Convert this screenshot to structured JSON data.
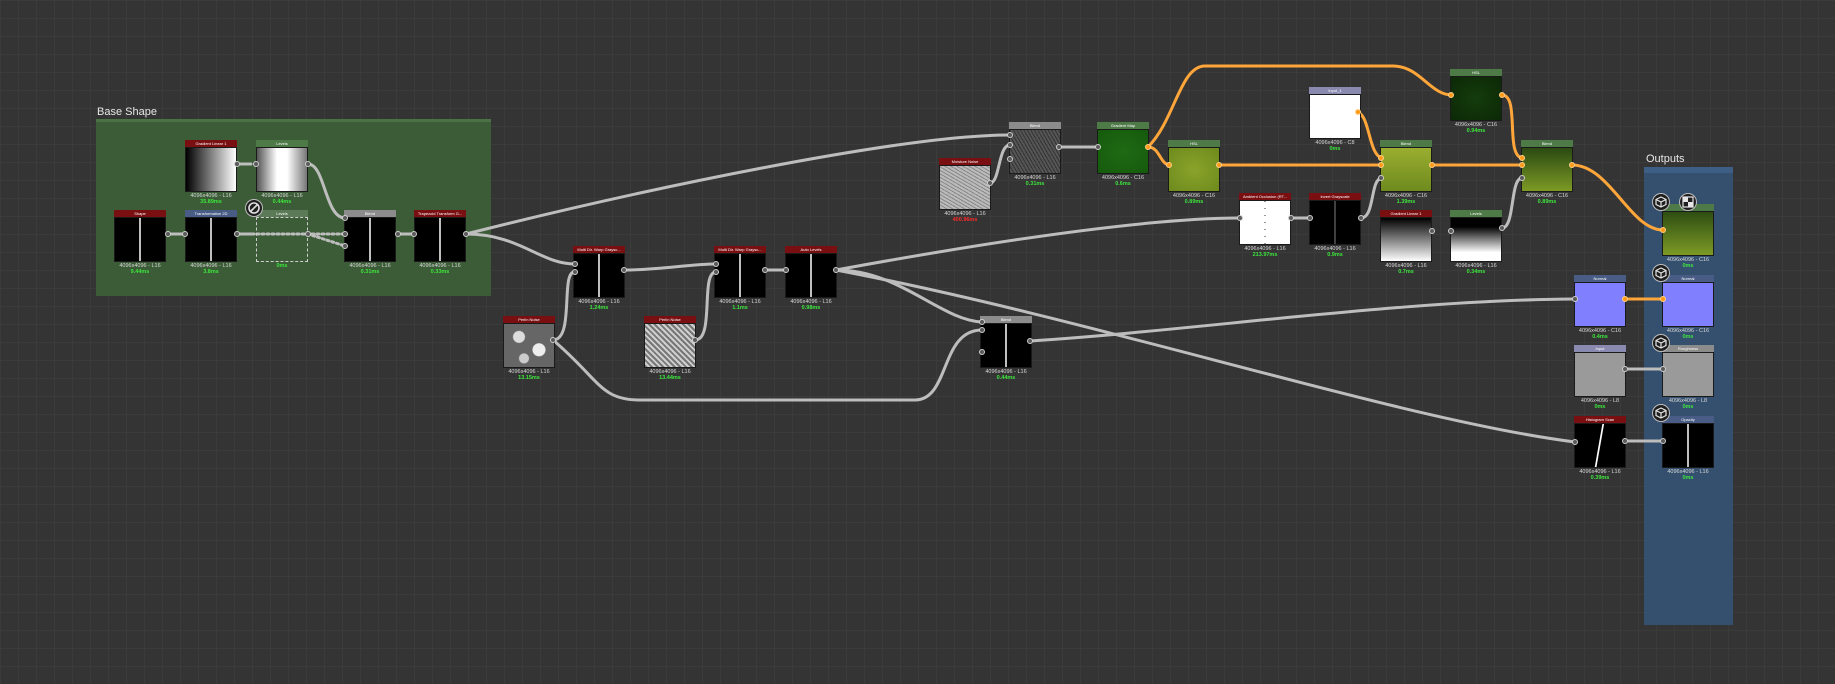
{
  "frames": {
    "base_shape": {
      "title": "Base Shape"
    },
    "outputs": {
      "title": "Outputs"
    }
  },
  "colors": {
    "canvas": "#343434",
    "frame_base_shape": "#3a5a35",
    "frame_outputs": "#2f4a6b",
    "hdr_red": "#7a0f12",
    "hdr_grey": "#8c8c8c",
    "hdr_green": "#4e7a48",
    "hdr_blue": "#485c86",
    "hdr_lavender": "#8a8ab0",
    "wire_grey": "#bdbdbd",
    "wire_orange": "#ffa63a",
    "time_green": "#3de63d",
    "time_red": "#ff2a2a"
  },
  "nodes": {
    "gradient_linear_1_top": {
      "label": "Gradient Linear 1",
      "res": "4096x4096 - L16",
      "time": "35.89ms"
    },
    "levels_top": {
      "label": "Levels",
      "res": "4096x4096 - L16",
      "time": "0.44ms"
    },
    "shape": {
      "label": "Shape",
      "res": "4096x4096 - L16",
      "time": "9.44ms"
    },
    "transformation_2d": {
      "label": "Transformation 2D",
      "res": "4096x4096 - L16",
      "time": "3.8ms"
    },
    "levels_disabled": {
      "label": "Levels",
      "res": "",
      "time": "0ms"
    },
    "blend_base": {
      "label": "Blend",
      "res": "4096x4096 - L16",
      "time": "0.31ms"
    },
    "trapezoid_transform": {
      "label": "Trapezoid Transform G...",
      "res": "4096x4096 - L16",
      "time": "0.33ms"
    },
    "perlin_noise_1": {
      "label": "Perlin Noise",
      "res": "4096x4096 - L16",
      "time": "13.15ms"
    },
    "multi_dir_warp_1": {
      "label": "Multi Dir. Warp Graysc...",
      "res": "4096x4096 - L16",
      "time": "1.24ms"
    },
    "perlin_noise_2": {
      "label": "Perlin Noise",
      "res": "4096x4096 - L16",
      "time": "13.44ms"
    },
    "multi_dir_warp_2": {
      "label": "Multi Dir. Warp Graysc...",
      "res": "4096x4096 - L16",
      "time": "1.1ms"
    },
    "auto_levels": {
      "label": "Auto Levels",
      "res": "4096x4096 - L16",
      "time": "0.98ms"
    },
    "blend_mid": {
      "label": "Blend",
      "res": "4096x4096 - L16",
      "time": "0.44ms"
    },
    "moisture_noise": {
      "label": "Moisture Noise",
      "res": "4096x4096 - L16",
      "time": "400.96ms"
    },
    "blend_top": {
      "label": "Blend",
      "res": "4096x4096 - L16",
      "time": "0.31ms"
    },
    "gradient_map": {
      "label": "Gradient Map",
      "res": "4096x4096 - C16",
      "time": "0.6ms"
    },
    "hsl_1": {
      "label": "HSL",
      "res": "4096x4096 - C16",
      "time": "0.89ms"
    },
    "input_1": {
      "label": "Input_1",
      "res": "4096x4096 - C8",
      "time": "0ms"
    },
    "ambient_occlusion": {
      "label": "Ambient Occlusion (RT...",
      "res": "4096x4096 - L16",
      "time": "213.97ms"
    },
    "invert_grayscale": {
      "label": "Invert Grayscale",
      "res": "4096x4096 - L16",
      "time": "0.9ms"
    },
    "blend_color_1": {
      "label": "Blend",
      "res": "4096x4096 - C16",
      "time": "1.39ms"
    },
    "gradient_linear_1_right": {
      "label": "Gradient Linear 1",
      "res": "4096x4096 - L16",
      "time": "0.7ms"
    },
    "levels_right": {
      "label": "Levels",
      "res": "4096x4096 - L16",
      "time": "0.34ms"
    },
    "hsl_2": {
      "label": "HSL",
      "res": "4096x4096 - C16",
      "time": "0.94ms"
    },
    "blend_color_2": {
      "label": "Blend",
      "res": "4096x4096 - C16",
      "time": "0.89ms"
    },
    "normal_in": {
      "label": "Normal",
      "res": "4096x4096 - C16",
      "time": "0.4ms"
    },
    "input_2": {
      "label": "Input",
      "res": "4096x4096 - L8",
      "time": "0ms"
    },
    "histogram_scan": {
      "label": "Histogram Scan",
      "res": "4096x4096 - L16",
      "time": "0.39ms"
    },
    "out_basecolor": {
      "label": "",
      "res": "4096x4096 - C16",
      "time": "0ms"
    },
    "out_normal": {
      "label": "Normal",
      "res": "4096x4096 - C16",
      "time": "0ms"
    },
    "out_roughness": {
      "label": "Roughness",
      "res": "4096x4096 - L8",
      "time": "0ms"
    },
    "out_opacity": {
      "label": "Opacity",
      "res": "4096x4096 - L16",
      "time": "0ms"
    }
  },
  "icons": {
    "output": "cube-icon",
    "bypass": "disabled-icon",
    "link": "linked-icon"
  }
}
